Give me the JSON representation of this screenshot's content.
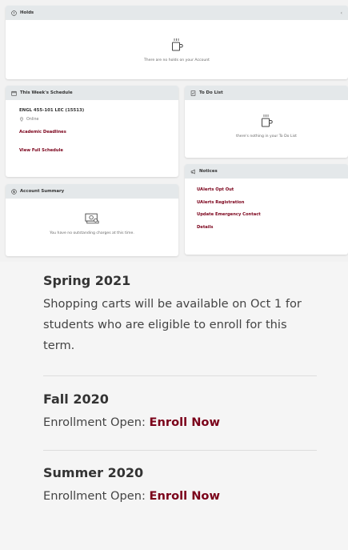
{
  "holds": {
    "title": "Holds",
    "empty_text": "There are no holds on your Account"
  },
  "schedule": {
    "title": "This Week's Schedule",
    "course": "ENGL 455-101 LEC (15513)",
    "location": "Online",
    "deadlines_link": "Academic Deadlines",
    "view_link": "View Full Schedule"
  },
  "todo": {
    "title": "To Do List",
    "empty_text": "there's nothing in your To Do List"
  },
  "notices": {
    "title": "Notices",
    "links": [
      "UAlerts Opt Out",
      "UAlerts Registration",
      "Update Emergency Contact",
      "Details"
    ]
  },
  "account": {
    "title": "Account Summary",
    "empty_text": "You have no outstanding charges at this time."
  },
  "terms": [
    {
      "title": "Spring 2021",
      "lines": [
        "Shopping carts will be available on Oct 1 for",
        "students who are eligible to enroll for this",
        "term."
      ]
    },
    {
      "title": "Fall 2020",
      "prefix": "Enrollment Open: ",
      "link": "Enroll Now"
    },
    {
      "title": "Summer 2020",
      "prefix": "Enrollment Open: ",
      "link": "Enroll Now"
    }
  ],
  "colors": {
    "accent": "#7a0019",
    "header_bg": "#e4e8ea",
    "page_bg": "#f2f2f2"
  }
}
